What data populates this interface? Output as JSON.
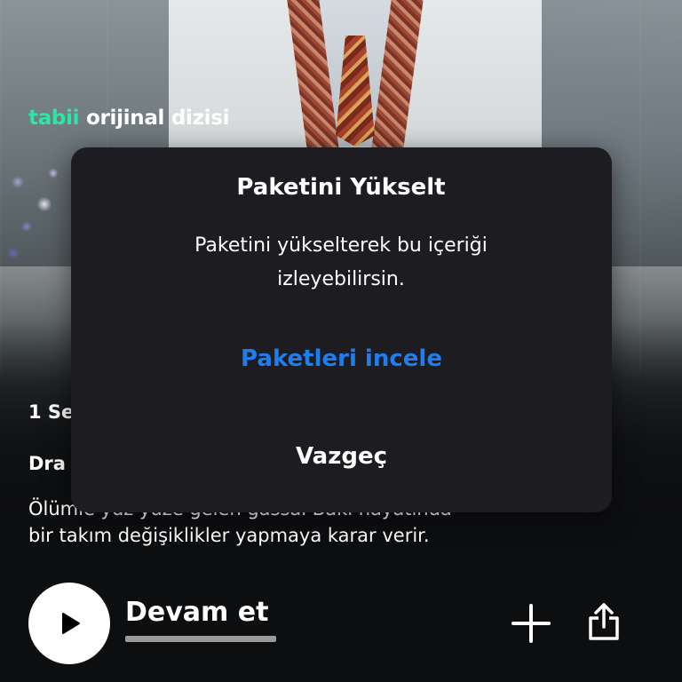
{
  "brand": {
    "accent": "tabii",
    "rest": "orijinal dizisi"
  },
  "details": {
    "season_line": "1 Se",
    "genre_line": "Dra",
    "synopsis_line1": "Ölümle yüz yüze gelen gassal Baki hayatında",
    "synopsis_line2": "bir takım değişiklikler yapmaya karar verir."
  },
  "actions": {
    "continue_label": "Devam et",
    "progress_fraction": 1.0,
    "play_icon": "play-icon",
    "add_icon": "plus-icon",
    "share_icon": "share-icon"
  },
  "dialog": {
    "title": "Paketini Yükselt",
    "message": "Paketini yükselterek bu içeriği izleyebilirsin.",
    "primary_action": "Paketleri incele",
    "secondary_action": "Vazgeç"
  },
  "colors": {
    "brand_accent": "#2fe5a6",
    "link_blue": "#1e7ef0",
    "dialog_bg": "#1c1c21"
  }
}
